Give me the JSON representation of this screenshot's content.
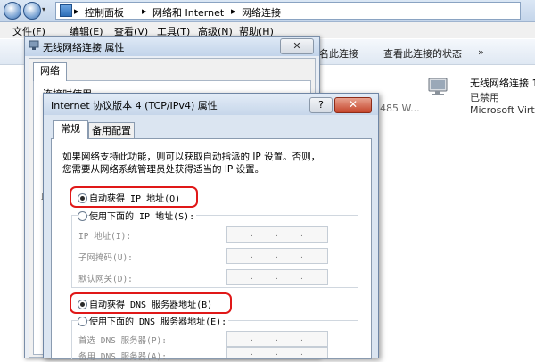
{
  "address": {
    "crumbs": [
      "控制面板",
      "网络和 Internet",
      "网络连接"
    ],
    "separators": [
      "▸",
      "▸",
      "▸"
    ]
  },
  "menu": [
    "文件(F)",
    "编辑(E)",
    "查看(V)",
    "工具(T)",
    "高级(N)",
    "帮助(H)"
  ],
  "toolbar": {
    "rename_partial": "名此连接",
    "view_status": "查看此连接的状态",
    "more": "»"
  },
  "adapter": {
    "name": "无线网络连接 1",
    "status": "已禁用",
    "device": "Microsoft Virt",
    "partial_text": "485 W..."
  },
  "back_dialog": {
    "title": "无线网络连接 属性",
    "tab": "网络",
    "connect_using_partial": "连接时使用",
    "side_char": "此"
  },
  "front_dialog": {
    "title": "Internet 协议版本 4 (TCP/IPv4) 属性",
    "help": "?",
    "close": "✕",
    "tabs": [
      "常规",
      "备用配置"
    ],
    "description_line1": "如果网络支持此功能，则可以获取自动指派的 IP 设置。否则，",
    "description_line2": "您需要从网络系统管理员处获得适当的 IP 设置。",
    "ip_auto": "自动获得 IP 地址(O)",
    "ip_manual": "使用下面的 IP 地址(S):",
    "ip_fields": [
      "IP 地址(I):",
      "子网掩码(U):",
      "默认网关(D):"
    ],
    "dns_auto": "自动获得 DNS 服务器地址(B)",
    "dns_manual": "使用下面的 DNS 服务器地址(E):",
    "dns_fields": [
      "首选 DNS 服务器(P):",
      "备用 DNS 服务器(A):"
    ],
    "ip_dot": "."
  },
  "colors": {
    "highlight": "#e01818"
  }
}
